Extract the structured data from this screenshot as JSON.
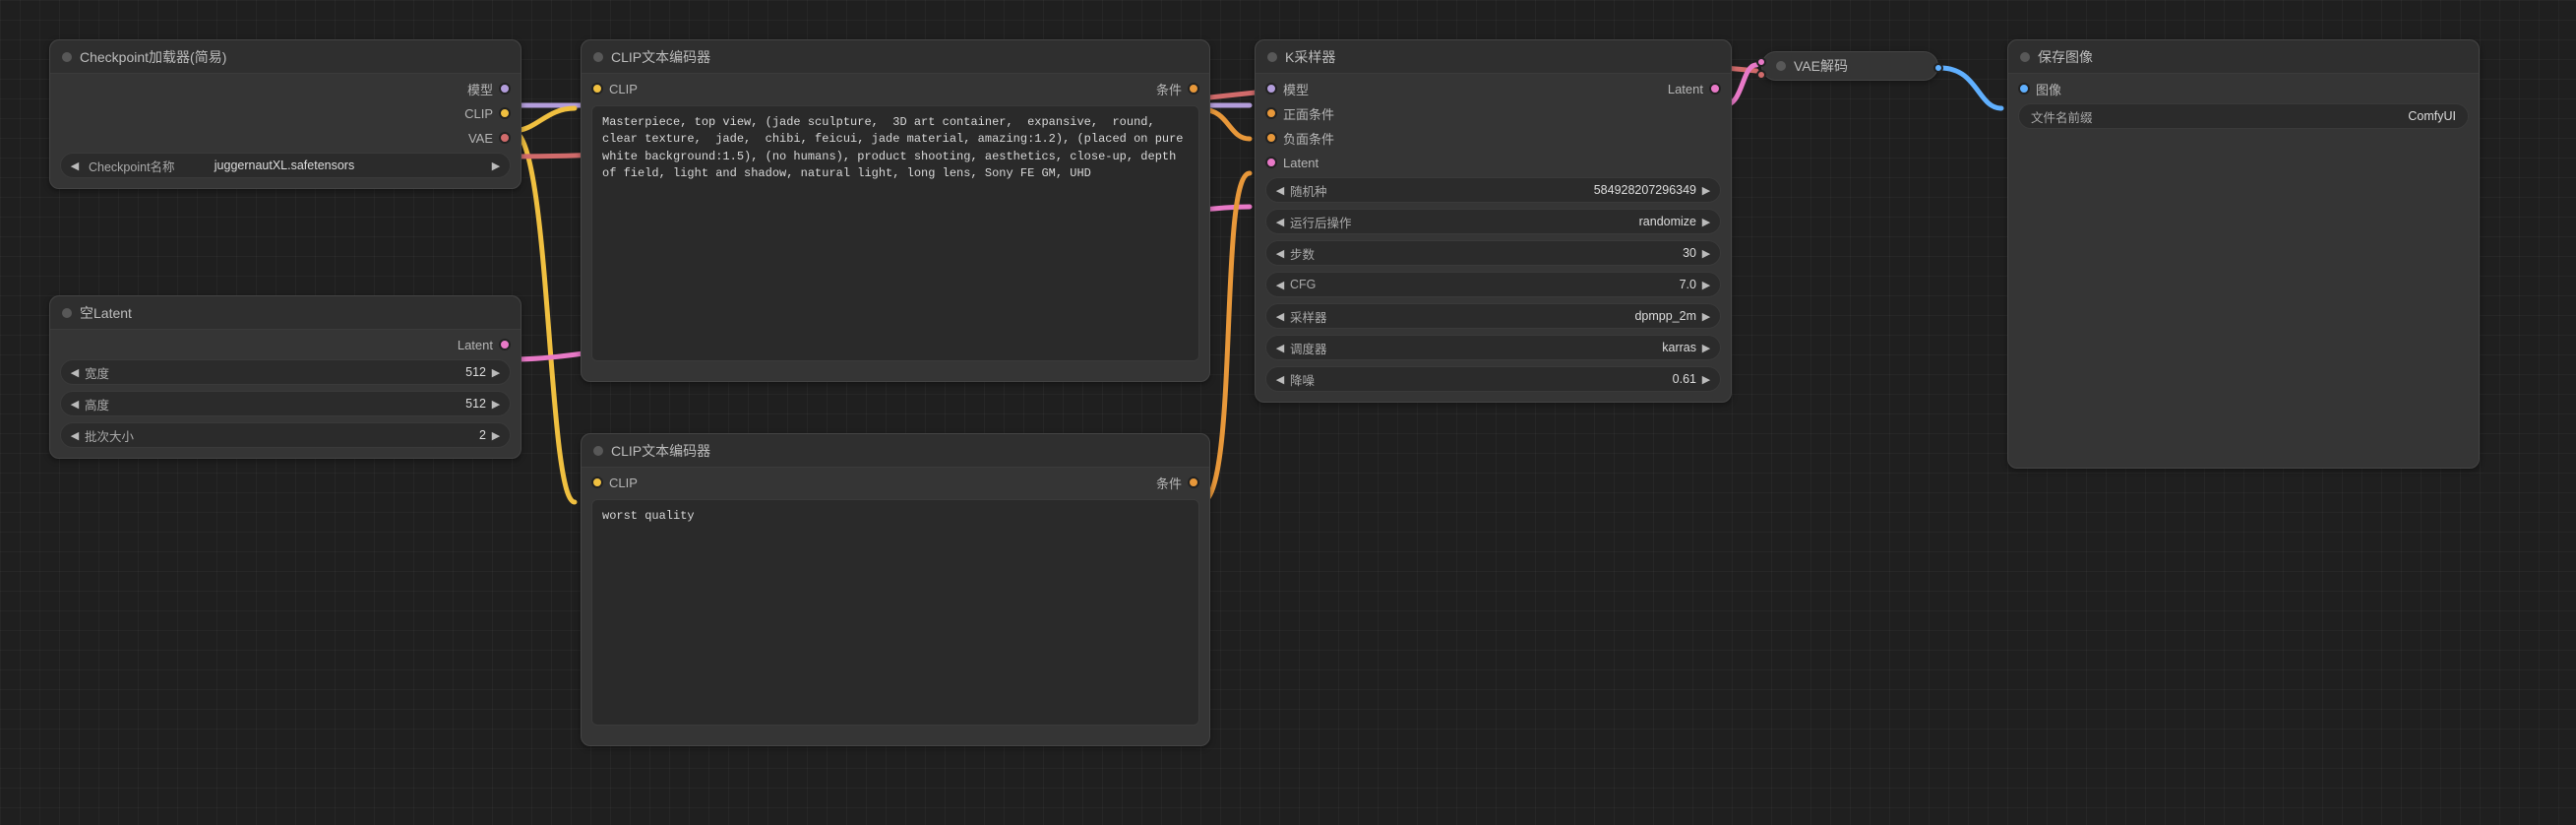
{
  "nodes": {
    "checkpoint": {
      "title": "Checkpoint加载器(简易)",
      "outputs": {
        "model": "模型",
        "clip": "CLIP",
        "vae": "VAE"
      },
      "widget": {
        "label": "Checkpoint名称",
        "value": "juggernautXL.safetensors"
      }
    },
    "latent": {
      "title": "空Latent",
      "outputs": {
        "latent": "Latent"
      },
      "widgets": {
        "width": {
          "label": "宽度",
          "value": "512"
        },
        "height": {
          "label": "高度",
          "value": "512"
        },
        "batch": {
          "label": "批次大小",
          "value": "2"
        }
      }
    },
    "clip_pos": {
      "title": "CLIP文本编码器",
      "inputs": {
        "clip": "CLIP"
      },
      "outputs": {
        "cond": "条件"
      },
      "text": "Masterpiece, top view, (jade sculpture,  3D art container,  expansive,  round,  clear texture,  jade,  chibi, feicui, jade material, amazing:1.2), (placed on pure white background:1.5), (no humans), product shooting, aesthetics, close-up, depth of field, light and shadow, natural light, long lens, Sony FE GM, UHD"
    },
    "clip_neg": {
      "title": "CLIP文本编码器",
      "inputs": {
        "clip": "CLIP"
      },
      "outputs": {
        "cond": "条件"
      },
      "text": "worst quality"
    },
    "ksampler": {
      "title": "K采样器",
      "inputs": {
        "model": "模型",
        "positive": "正面条件",
        "negative": "负面条件",
        "latent": "Latent"
      },
      "outputs": {
        "latent": "Latent"
      },
      "widgets": {
        "seed": {
          "label": "随机种",
          "value": "584928207296349"
        },
        "after": {
          "label": "运行后操作",
          "value": "randomize"
        },
        "steps": {
          "label": "步数",
          "value": "30"
        },
        "cfg": {
          "label": "CFG",
          "value": "7.0"
        },
        "sampler": {
          "label": "采样器",
          "value": "dpmpp_2m"
        },
        "scheduler": {
          "label": "调度器",
          "value": "karras"
        },
        "denoise": {
          "label": "降噪",
          "value": "0.61"
        }
      }
    },
    "vae_decode": {
      "title": "VAE解码"
    },
    "save": {
      "title": "保存图像",
      "inputs": {
        "image": "图像"
      },
      "widget": {
        "label": "文件名前缀",
        "value": "ComfyUI"
      }
    }
  }
}
